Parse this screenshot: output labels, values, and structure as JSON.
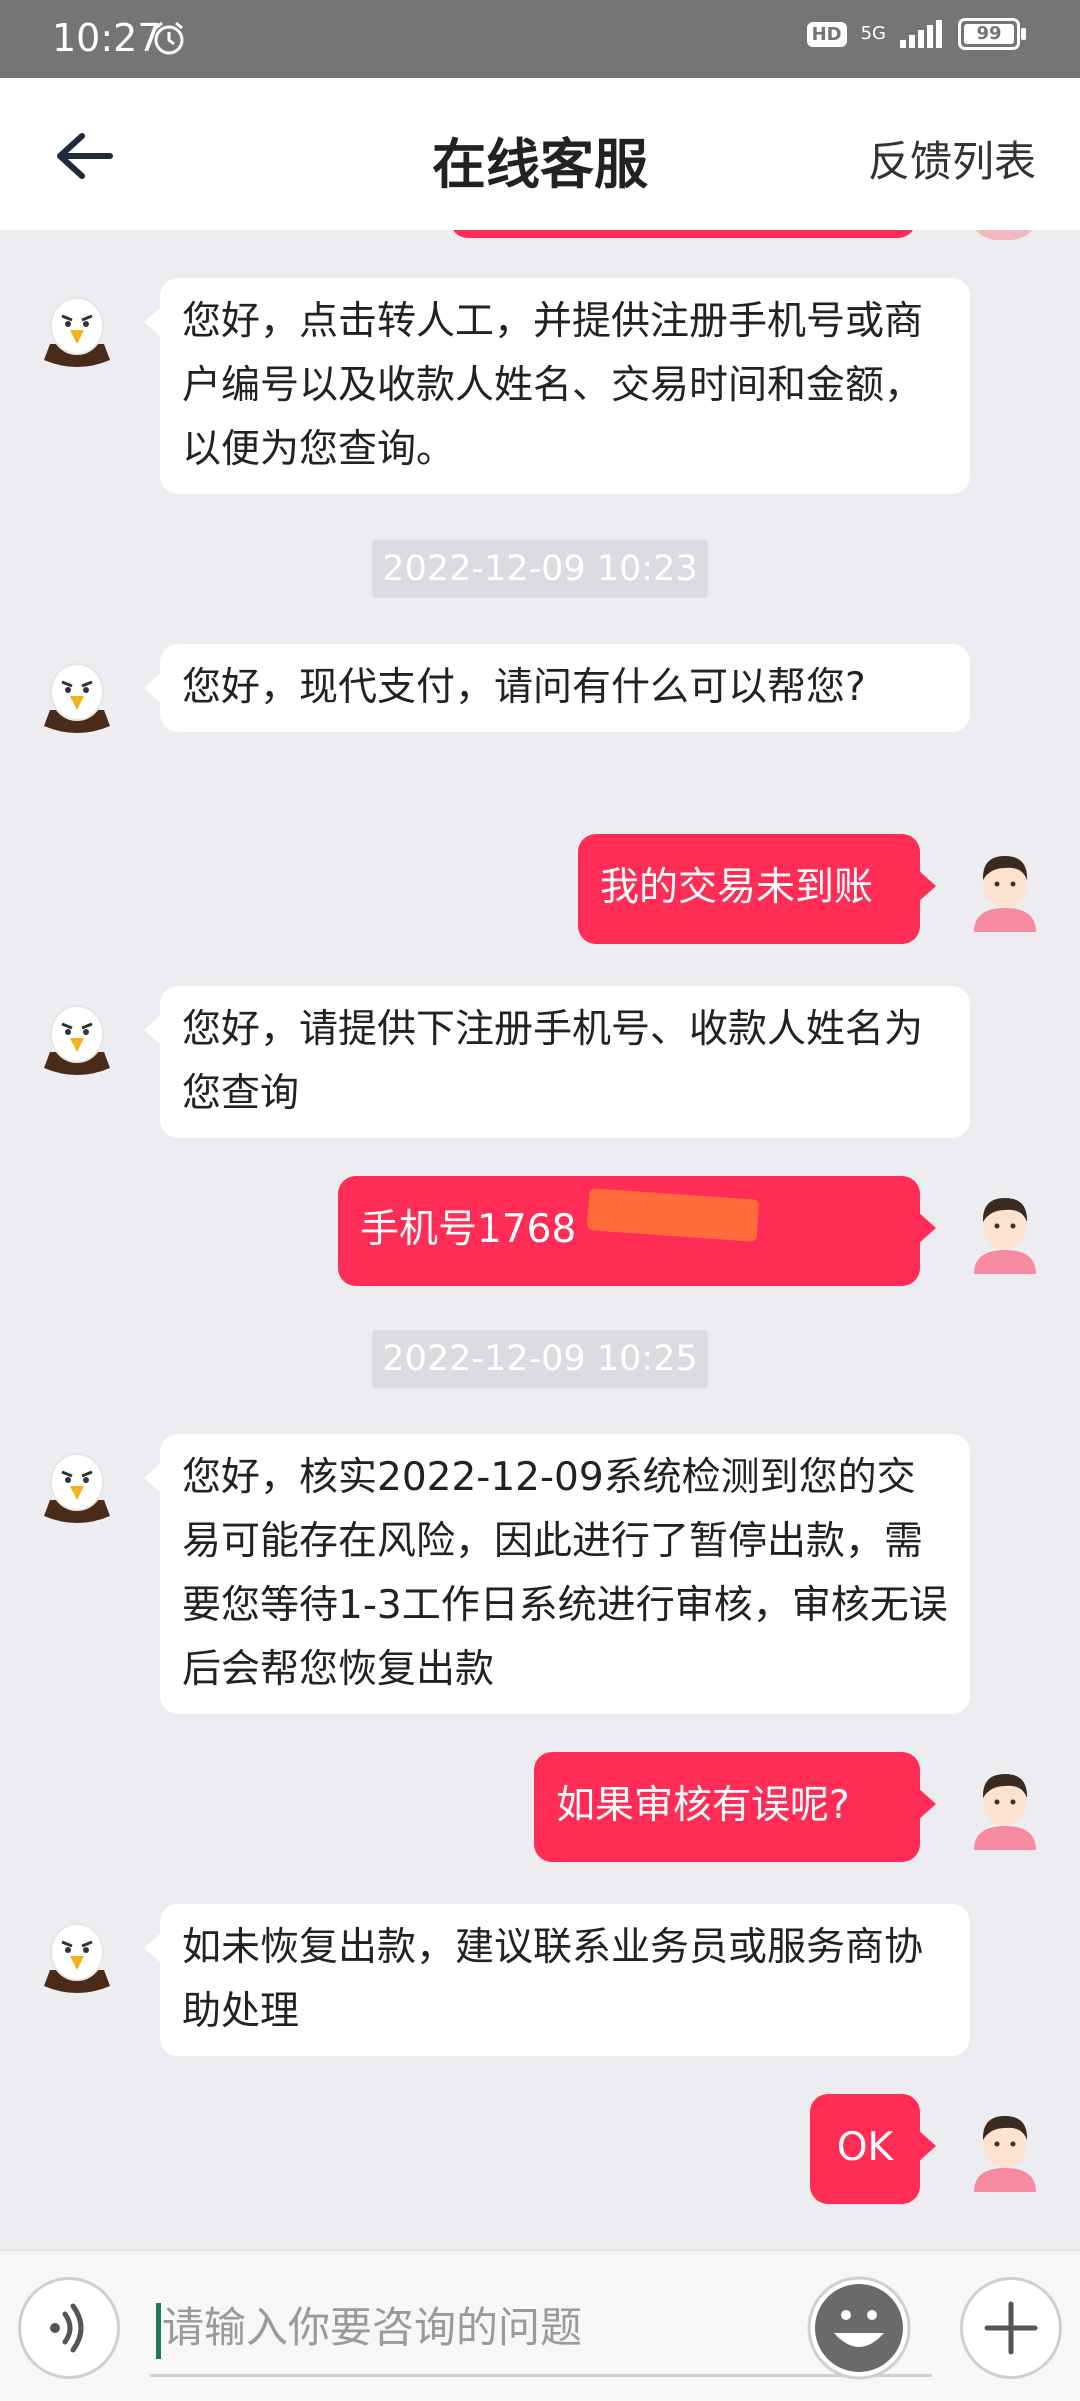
{
  "status_bar": {
    "time": "10:27",
    "network": "5G",
    "battery": "99",
    "hd": "HD"
  },
  "header": {
    "title": "在线客服",
    "feedback_label": "反馈列表",
    "back_icon": "back-arrow-icon"
  },
  "messages": [
    {
      "side": "left",
      "text": "您好，点击转人工，并提供注册手机号或商户编号以及收款人姓名、交易时间和金额，以便为您查询。"
    },
    {
      "type": "timestamp",
      "text": "2022-12-09 10:23"
    },
    {
      "side": "left",
      "text": "您好，现代支付，请问有什么可以帮您?"
    },
    {
      "side": "right",
      "text": "我的交易未到账"
    },
    {
      "side": "left",
      "text": "您好，请提供下注册手机号、收款人姓名为您查询"
    },
    {
      "side": "right",
      "text": "手机号1768"
    },
    {
      "type": "timestamp",
      "text": "2022-12-09 10:25"
    },
    {
      "side": "left",
      "text": "您好，核实2022-12-09系统检测到您的交易可能存在风险，因此进行了暂停出款，需要您等待1-3工作日系统进行审核，审核无误后会帮您恢复出款"
    },
    {
      "side": "right",
      "text": "如果审核有误呢?"
    },
    {
      "side": "left",
      "text": "如未恢复出款，建议联系业务员或服务商协助处理"
    },
    {
      "side": "right",
      "text": "OK"
    }
  ],
  "input_bar": {
    "placeholder": "请输入你要咨询的问题",
    "voice_icon": "voice-icon",
    "emoji_icon": "emoji-icon",
    "plus_icon": "plus-icon"
  },
  "colors": {
    "accent": "#ff2d55",
    "chat_bg": "#ececf1",
    "agent_bubble": "#ffffff",
    "status_bar": "#757575"
  }
}
